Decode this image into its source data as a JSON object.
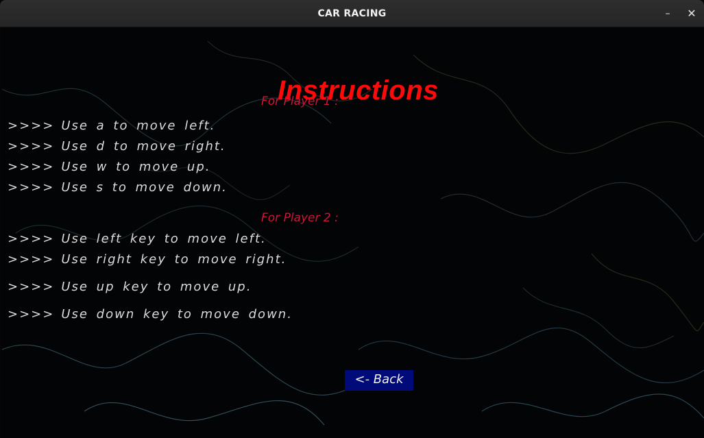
{
  "window": {
    "title": "CAR RACING",
    "minimize_icon": "minimize-icon",
    "close_icon": "close-icon",
    "minimize_glyph": "–",
    "close_glyph": "✕"
  },
  "heading": "Instructions",
  "player1": {
    "label": "For Player 1 :",
    "lines": [
      {
        "prefix": ">>>>",
        "text": "Use  a  to  move  left."
      },
      {
        "prefix": ">>>>",
        "text": "Use  d  to  move  right."
      },
      {
        "prefix": ">>>>",
        "text": "Use  w  to  move  up."
      },
      {
        "prefix": ">>>>",
        "text": "Use  s  to  move  down."
      }
    ]
  },
  "player2": {
    "label": "For Player 2 :",
    "lines": [
      {
        "prefix": ">>>>",
        "text": "Use  left key to  move  left."
      },
      {
        "prefix": ">>>>",
        "text": "Use  right key to  move  right."
      },
      {
        "prefix": ">>>>",
        "text": "Use  up key to  move  up."
      },
      {
        "prefix": ">>>>",
        "text": "Use  down key to  move  down."
      }
    ]
  },
  "back_button": {
    "label": "<- Back"
  },
  "colors": {
    "heading": "#ff0a0a",
    "section_label": "#d4123a",
    "instruction_text": "#dcdcdc",
    "back_button_bg": "#000a78",
    "background": "#030406"
  }
}
